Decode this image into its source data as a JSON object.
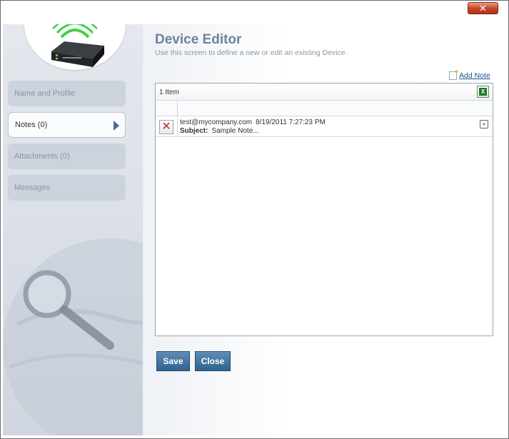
{
  "window": {
    "close_label": "✕"
  },
  "sidebar": {
    "items": [
      {
        "label": "Name and Profile",
        "active": false
      },
      {
        "label": "Notes (0)",
        "active": true
      },
      {
        "label": "Attachments (0)",
        "active": false
      },
      {
        "label": "Messages",
        "active": false
      }
    ]
  },
  "header": {
    "title": "Device Editor",
    "subtitle": "Use this screen to define a new or edit an existing Device."
  },
  "toolbar": {
    "add_note_label": "Add Note"
  },
  "grid": {
    "item_count": "1 Item",
    "rows": [
      {
        "author": "test@mycompany.com",
        "date": "8/19/2011 7:27:23 PM",
        "subject_label": "Subject:",
        "subject": "Sample Note..."
      }
    ]
  },
  "actions": {
    "save_label": "Save",
    "close_label": "Close"
  },
  "colors": {
    "accent": "#2f628f",
    "title": "#6f829b",
    "link": "#1b4f8a",
    "close_red": "#c8462a"
  },
  "icons": [
    "device-icon",
    "note-add-icon",
    "excel-export-icon",
    "delete-icon",
    "expand-icon",
    "chevron-right-icon"
  ]
}
